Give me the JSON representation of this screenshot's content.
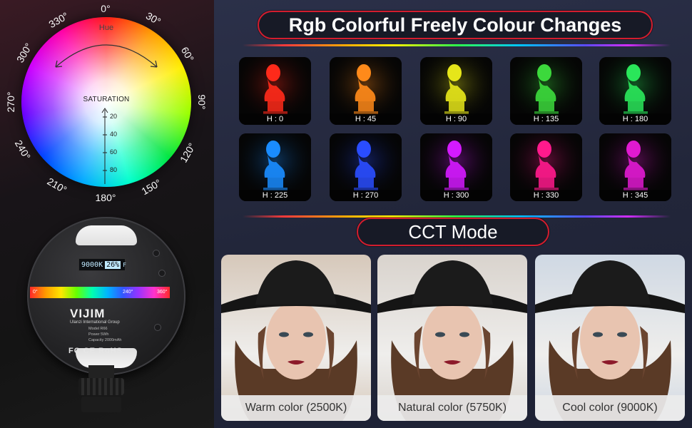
{
  "colors": {
    "accent_border": "#d31d2e",
    "panel_bg": "#22263a"
  },
  "wheel": {
    "hue_label": "Hue",
    "saturation_label": "SATURATION",
    "degrees": [
      "0°",
      "30°",
      "60°",
      "90°",
      "120°",
      "150°",
      "180°",
      "210°",
      "240°",
      "270°",
      "300°",
      "330°"
    ],
    "saturation_ticks": [
      "20",
      "40",
      "60",
      "80"
    ]
  },
  "device": {
    "lcd_temp": "9000K",
    "lcd_percent": "26%",
    "lcd_flag": "F",
    "strip_marks": [
      "0°",
      "240°",
      "360°"
    ],
    "brand": "VIJIM",
    "brand_sub": "Ulanzi International Group",
    "spec_lines": [
      "Model R66",
      "Power 5Wh",
      "Capacity 2000mAh"
    ],
    "certifications": "FC CE RoHS"
  },
  "rgb_section": {
    "title": "Rgb Colorful Freely Colour Changes",
    "tiles": [
      {
        "caption": "H : 0",
        "color": "#ff2a1a"
      },
      {
        "caption": "H : 45",
        "color": "#ff8a1a"
      },
      {
        "caption": "H : 90",
        "color": "#e6e61a"
      },
      {
        "caption": "H : 135",
        "color": "#3cd93c"
      },
      {
        "caption": "H : 180",
        "color": "#2ae65a"
      },
      {
        "caption": "H : 225",
        "color": "#1a8cff"
      },
      {
        "caption": "H : 270",
        "color": "#2a4dff"
      },
      {
        "caption": "H : 300",
        "color": "#d41aff"
      },
      {
        "caption": "H : 330",
        "color": "#ff1a8c"
      },
      {
        "caption": "H : 345",
        "color": "#e01ad0"
      }
    ]
  },
  "cct_section": {
    "title": "CCT Mode",
    "portraits": [
      {
        "caption": "Warm color (2500K)",
        "tint": "#d6c8ba"
      },
      {
        "caption": "Natural color (5750K)",
        "tint": "#d9d3cd"
      },
      {
        "caption": "Cool color (9000K)",
        "tint": "#cfd8e3"
      }
    ]
  }
}
